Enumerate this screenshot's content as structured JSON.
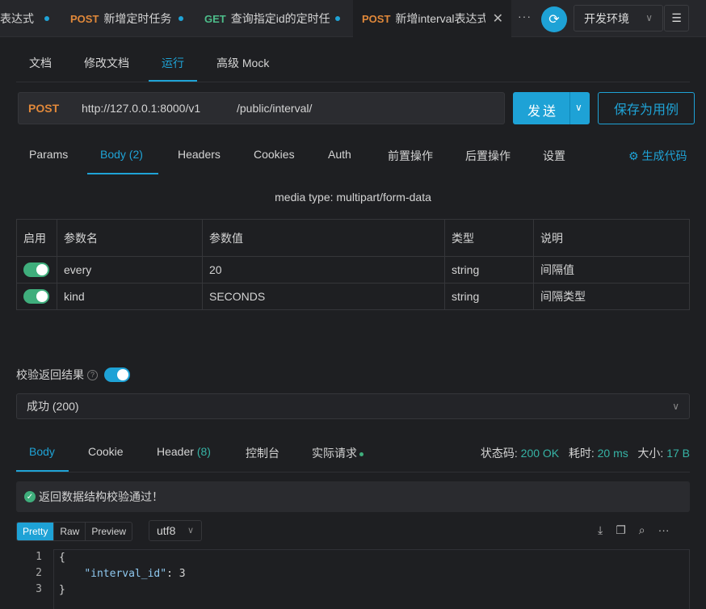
{
  "tabs": [
    {
      "method": "",
      "title": "表达式",
      "dirty": true
    },
    {
      "method": "POST",
      "title": "新增定时任务",
      "dirty": true
    },
    {
      "method": "GET",
      "title": "查询指定id的定时任",
      "dirty": true
    },
    {
      "method": "POST",
      "title": "新增interval表达式",
      "dirty": false,
      "active": true
    }
  ],
  "tab_more": "···",
  "environment": "开发环境",
  "subtabs": [
    "文档",
    "修改文档",
    "运行",
    "高级 Mock"
  ],
  "request": {
    "method": "POST",
    "host": "http://127.0.0.1:8000/v1",
    "path": "/public/interval/",
    "send_label": "发送",
    "save_label": "保存为用例"
  },
  "request_tabs": [
    "Params",
    "Body (2)",
    "Headers",
    "Cookies",
    "Auth",
    "前置操作",
    "后置操作",
    "设置"
  ],
  "generate_code": "生成代码",
  "media_type": "media type: multipart/form-data",
  "params_table": {
    "headers": [
      "启用",
      "参数名",
      "参数值",
      "类型",
      "说明"
    ],
    "rows": [
      {
        "enabled": true,
        "name": "every",
        "value": "20",
        "type": "string",
        "desc": "间隔值"
      },
      {
        "enabled": true,
        "name": "kind",
        "value": "SECONDS",
        "type": "string",
        "desc": "间隔类型"
      }
    ]
  },
  "verify": {
    "label": "校验返回结果",
    "help": "?",
    "result": "成功 (200)"
  },
  "response_tabs": {
    "body": "Body",
    "cookie": "Cookie",
    "header": "Header",
    "header_count": "(8)",
    "console": "控制台",
    "actual": "实际请求"
  },
  "status": {
    "code_label": "状态码:",
    "code": "200 OK",
    "time_label": "耗时:",
    "time": "20 ms",
    "size_label": "大小:",
    "size": "17 B"
  },
  "verify_pass": "返回数据结构校验通过！",
  "view_modes": [
    "Pretty",
    "Raw",
    "Preview"
  ],
  "encoding": "utf8",
  "code_lines": {
    "numbers": [
      "1",
      "2",
      "3"
    ],
    "open": "{",
    "key": "\"interval_id\"",
    "colon": ": ",
    "value": "3",
    "close": "}"
  },
  "colors": {
    "accent": "#1ea2d6",
    "post": "#e0883a",
    "get": "#4dbd8a",
    "success": "#3fae7c"
  }
}
